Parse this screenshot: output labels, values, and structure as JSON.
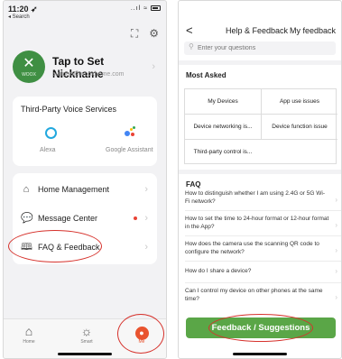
{
  "left": {
    "status": {
      "time": "11:20 ➶",
      "back": "◂ Search",
      "icons": "..ıl ≈"
    },
    "top_icons": {
      "scan": "scan-icon",
      "settings": "gear-icon"
    },
    "profile": {
      "nickname": "Tap to Set Nickname",
      "email": "support@wooxhome.com",
      "avatar_text": "WOOX"
    },
    "voice": {
      "title": "Third-Party Voice Services",
      "items": [
        {
          "label": "Alexa",
          "icon": "alexa-ring-icon"
        },
        {
          "label": "Google Assistant",
          "icon": "google-assistant-icon"
        }
      ]
    },
    "menu": [
      {
        "label": "Home Management",
        "icon": "home-icon"
      },
      {
        "label": "Message Center",
        "icon": "message-icon",
        "badge": "red-dot"
      },
      {
        "label": "FAQ & Feedback",
        "icon": "book-icon"
      }
    ],
    "tabs": [
      {
        "label": "Home",
        "icon": "home-icon"
      },
      {
        "label": "Smart",
        "icon": "sun-icon"
      },
      {
        "label": "Me",
        "icon": "person-icon",
        "active": true
      }
    ]
  },
  "right": {
    "nav": {
      "back": "<",
      "title": "Help & Feedback",
      "right": "My feedback"
    },
    "search": {
      "placeholder": "Enter your questions"
    },
    "most_asked": {
      "title": "Most Asked",
      "cells": [
        "My Devices",
        "App use issues",
        "Device networking is...",
        "Device function issue",
        "Third-party control is..."
      ]
    },
    "faq": {
      "title": "FAQ",
      "items": [
        "How to distinguish whether I am using 2.4G or 5G Wi-Fi network?",
        "How to set the time to 24-hour format or 12-hour format in the App?",
        "How does the camera use the scanning QR code to configure the network?",
        "How do I share a device?",
        "Can I control my device on other phones at the same time?"
      ]
    },
    "button": "Feedback / Suggestions"
  },
  "colors": {
    "accent_green": "#5aa647",
    "annotation_red": "#d6322c",
    "me_orange": "#e9542f",
    "alexa_blue": "#22a8de"
  }
}
